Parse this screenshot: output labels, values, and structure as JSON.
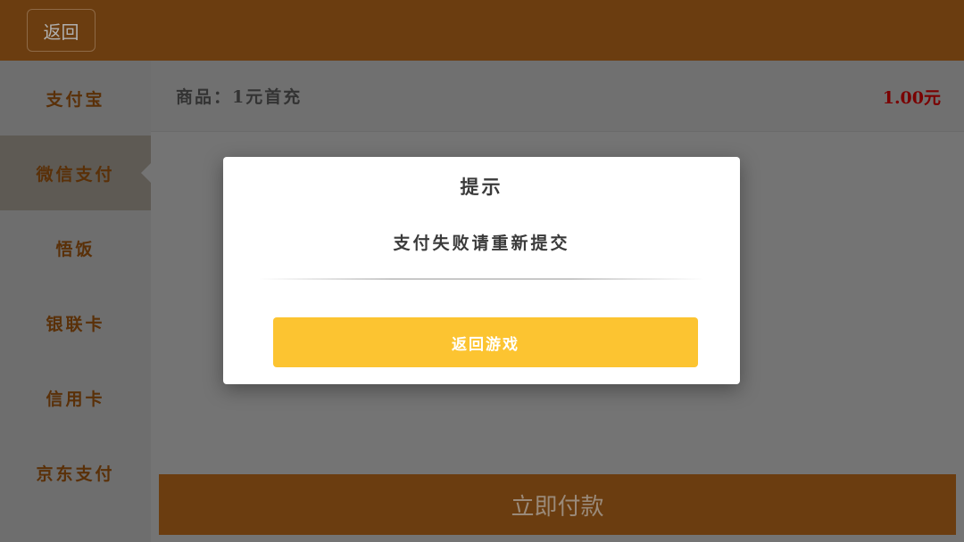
{
  "header": {
    "back_label": "返回"
  },
  "sidebar": {
    "items": [
      {
        "label": "支付宝",
        "active": false
      },
      {
        "label": "微信支付",
        "active": true
      },
      {
        "label": "悟饭",
        "active": false
      },
      {
        "label": "银联卡",
        "active": false
      },
      {
        "label": "信用卡",
        "active": false
      },
      {
        "label": "京东支付",
        "active": false
      }
    ]
  },
  "product": {
    "label": "商品：1元首充",
    "price": "1.00元"
  },
  "pay_button_label": "立即付款",
  "modal": {
    "title": "提示",
    "message": "支付失败请重新提交",
    "button_label": "返回游戏"
  },
  "colors": {
    "header_bg": "#6b3d10",
    "modal_button": "#fcc431",
    "price": "#7a0000"
  }
}
